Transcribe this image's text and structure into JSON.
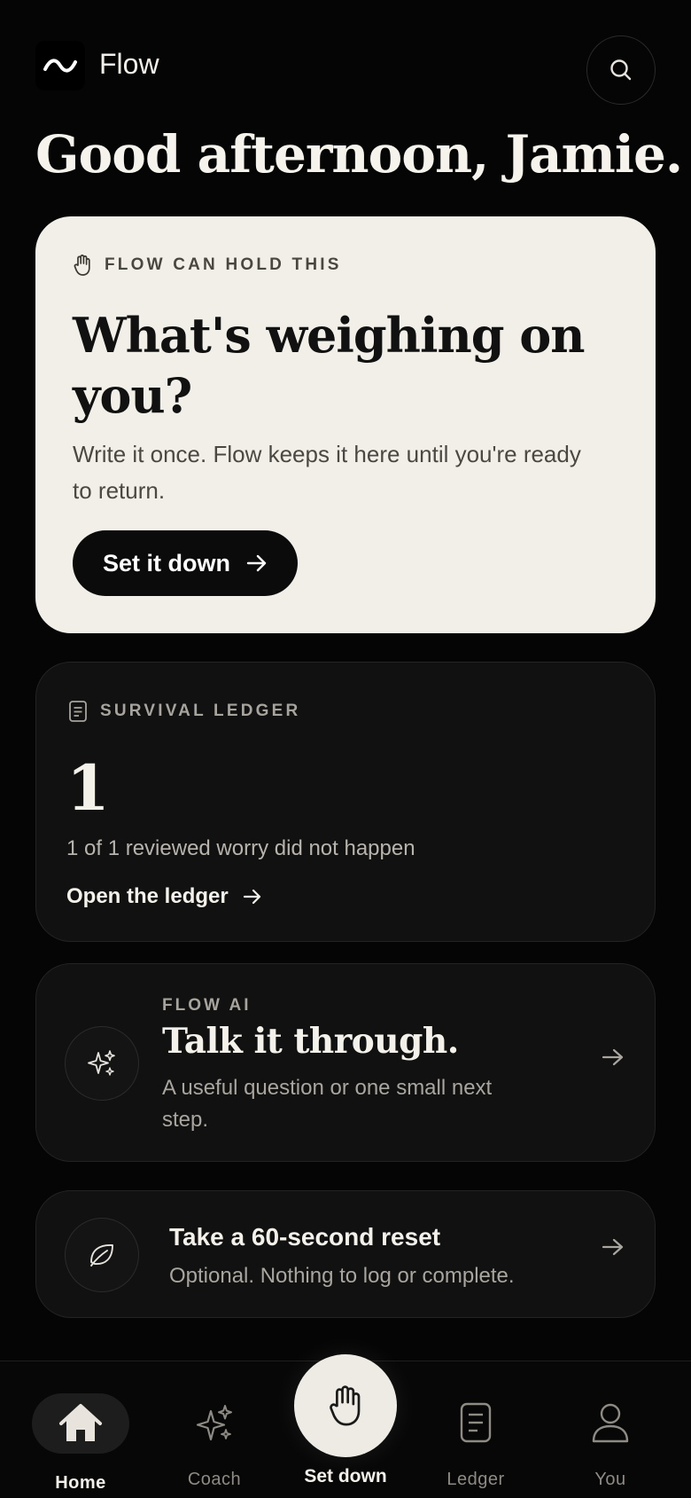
{
  "header": {
    "brand": "Flow",
    "logo_icon": "wave-logo-icon",
    "search_icon": "search-icon"
  },
  "greeting": "Good afternoon, Jamie.",
  "hero": {
    "eyebrow": "FLOW CAN HOLD THIS",
    "eyebrow_icon": "hand-icon",
    "title": "What's weighing on you?",
    "subtitle": "Write it once. Flow keeps it here until you're ready to return.",
    "cta_label": "Set it down"
  },
  "ledger": {
    "eyebrow": "SURVIVAL LEDGER",
    "eyebrow_icon": "document-icon",
    "count": "1",
    "description": "1 of 1 reviewed worry did not happen",
    "link_label": "Open the ledger"
  },
  "ai": {
    "kicker": "FLOW AI",
    "title": "Talk it through.",
    "subtitle": "A useful question or one small next step.",
    "icon": "sparkles-icon"
  },
  "reset": {
    "title": "Take a 60-second reset",
    "subtitle": "Optional. Nothing to log or complete.",
    "icon": "leaf-icon"
  },
  "nav": {
    "home": "Home",
    "coach": "Coach",
    "set_down": "Set down",
    "ledger": "Ledger",
    "you": "You"
  },
  "colors": {
    "background": "#050505",
    "hero_card": "#f2efe8",
    "card": "#111111",
    "accent_text": "#f4f1ea"
  }
}
